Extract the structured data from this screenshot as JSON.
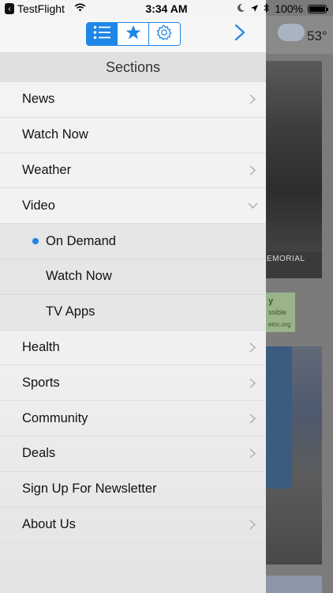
{
  "status_bar": {
    "back_app": "TestFlight",
    "time": "3:34 AM",
    "battery": "100%"
  },
  "toolbar": {
    "tabs": [
      {
        "name": "sections",
        "icon": "list-icon",
        "active": true
      },
      {
        "name": "favorites",
        "icon": "star-icon",
        "active": false
      },
      {
        "name": "settings",
        "icon": "gear-icon",
        "active": false
      }
    ]
  },
  "background": {
    "weather_temp": "53°",
    "photo_caption": "EMORIAL",
    "ad_line1": "y",
    "ad_line2": "ssible",
    "ad_line3": "einc.org"
  },
  "sections": {
    "title": "Sections",
    "items": [
      {
        "label": "News",
        "has_chevron": true
      },
      {
        "label": "Watch Now",
        "has_chevron": false
      },
      {
        "label": "Weather",
        "has_chevron": true
      },
      {
        "label": "Video",
        "has_chevron": true,
        "expanded": true
      },
      {
        "label": "On Demand",
        "sub": true,
        "selected": true
      },
      {
        "label": "Watch Now",
        "sub": true
      },
      {
        "label": "TV Apps",
        "sub": true
      },
      {
        "label": "Health",
        "has_chevron": true
      },
      {
        "label": "Sports",
        "has_chevron": true
      },
      {
        "label": "Community",
        "has_chevron": true
      },
      {
        "label": "Deals",
        "has_chevron": true
      },
      {
        "label": "Sign Up For Newsletter",
        "has_chevron": false
      },
      {
        "label": "About Us",
        "has_chevron": true
      }
    ]
  },
  "colors": {
    "accent": "#1e86e6",
    "chevron": "#b0b0b0"
  }
}
